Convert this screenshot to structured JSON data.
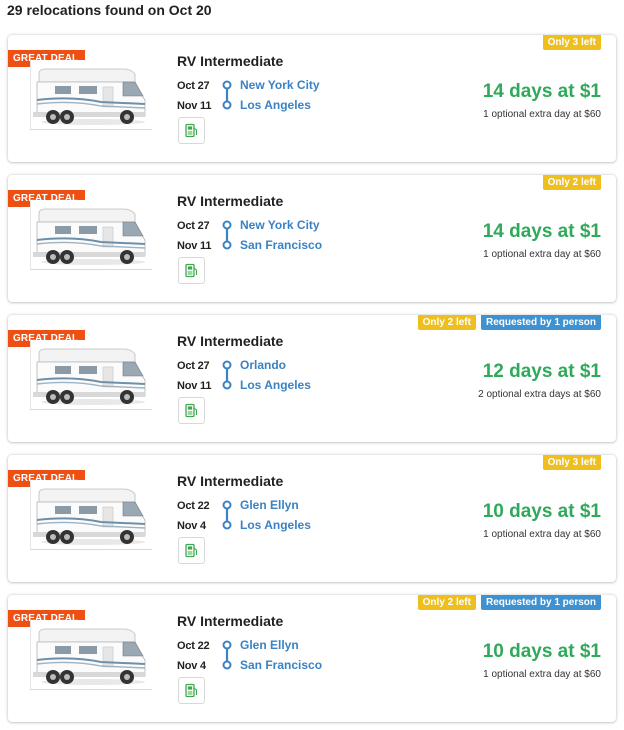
{
  "results": {
    "summary": "29 relocations found on Oct 20"
  },
  "colors": {
    "deal": "#ee5014",
    "city": "#3a82c4",
    "price": "#2fa95a",
    "left_tag": "#eebf1f",
    "requested_tag": "#3f92d2"
  },
  "icons": {
    "route": "route-line-icon",
    "fuel": "fuel-pump-icon",
    "vehicle": "rv-motorhome-image"
  },
  "cards": [
    {
      "badge": "GREAT DEAL",
      "vehicle": "RV Intermediate",
      "start_date": "Oct 27",
      "end_date": "Nov 11",
      "from": "New York City",
      "to": "Los Angeles",
      "price": "14 days at $1",
      "extra": "1 optional extra day at $60",
      "tags": [
        "Only 3 left"
      ]
    },
    {
      "badge": "GREAT DEAL",
      "vehicle": "RV Intermediate",
      "start_date": "Oct 27",
      "end_date": "Nov 11",
      "from": "New York City",
      "to": "San Francisco",
      "price": "14 days at $1",
      "extra": "1 optional extra day at $60",
      "tags": [
        "Only 2 left"
      ]
    },
    {
      "badge": "GREAT DEAL",
      "vehicle": "RV Intermediate",
      "start_date": "Oct 27",
      "end_date": "Nov 11",
      "from": "Orlando",
      "to": "Los Angeles",
      "price": "12 days at $1",
      "extra": "2 optional extra days at $60",
      "tags": [
        "Only 2 left",
        "Requested by 1 person"
      ]
    },
    {
      "badge": "GREAT DEAL",
      "vehicle": "RV Intermediate",
      "start_date": "Oct 22",
      "end_date": "Nov 4",
      "from": "Glen Ellyn",
      "to": "Los Angeles",
      "price": "10 days at $1",
      "extra": "1 optional extra day at $60",
      "tags": [
        "Only 3 left"
      ]
    },
    {
      "badge": "GREAT DEAL",
      "vehicle": "RV Intermediate",
      "start_date": "Oct 22",
      "end_date": "Nov 4",
      "from": "Glen Ellyn",
      "to": "San Francisco",
      "price": "10 days at $1",
      "extra": "1 optional extra day at $60",
      "tags": [
        "Only 2 left",
        "Requested by 1 person"
      ]
    }
  ]
}
